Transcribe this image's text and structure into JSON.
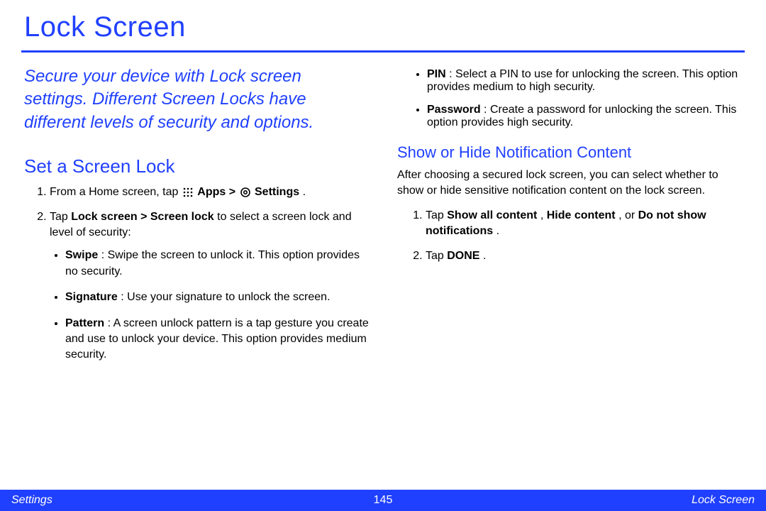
{
  "title": "Lock Screen",
  "intro": "Secure your device with Lock screen settings. Different Screen Locks have different levels of security and options.",
  "left": {
    "heading": "Set a Screen Lock",
    "step1_a": "From a Home screen, tap ",
    "step1_apps": "Apps",
    "step1_gt": " > ",
    "step1_settings": "Settings",
    "step1_end": ".",
    "step2_a": "Tap ",
    "step2_bold": "Lock screen > Screen lock",
    "step2_b": " to select a screen lock and level of security:",
    "bullets": {
      "swipe_label": "Swipe",
      "swipe_text": ": Swipe the screen to unlock it. This option provides no security.",
      "sig_label": "Signature",
      "sig_text": ": Use your signature to unlock the screen.",
      "pattern_label": "Pattern",
      "pattern_text": ": A screen unlock pattern is a tap gesture you create and use to unlock your device. This option provides medium security."
    }
  },
  "right": {
    "bullets": {
      "pin_label": "PIN",
      "pin_text": ": Select a PIN to use for unlocking the screen. This option provides medium to high security.",
      "pw_label": "Password",
      "pw_text": ": Create a password for unlocking the screen. This option provides high security."
    },
    "heading2": "Show or Hide Notification Content",
    "para": "After choosing a secured lock screen, you can select whether to show or hide sensitive notification content on the lock screen.",
    "step1_a": "Tap ",
    "step1_b1": "Show all content",
    "step1_c1": ", ",
    "step1_b2": "Hide content",
    "step1_c2": ", or ",
    "step1_b3": "Do not show notifications",
    "step1_end": ".",
    "step2_a": "Tap ",
    "step2_b": "DONE",
    "step2_end": "."
  },
  "footer": {
    "left": "Settings",
    "center": "145",
    "right": "Lock Screen"
  }
}
